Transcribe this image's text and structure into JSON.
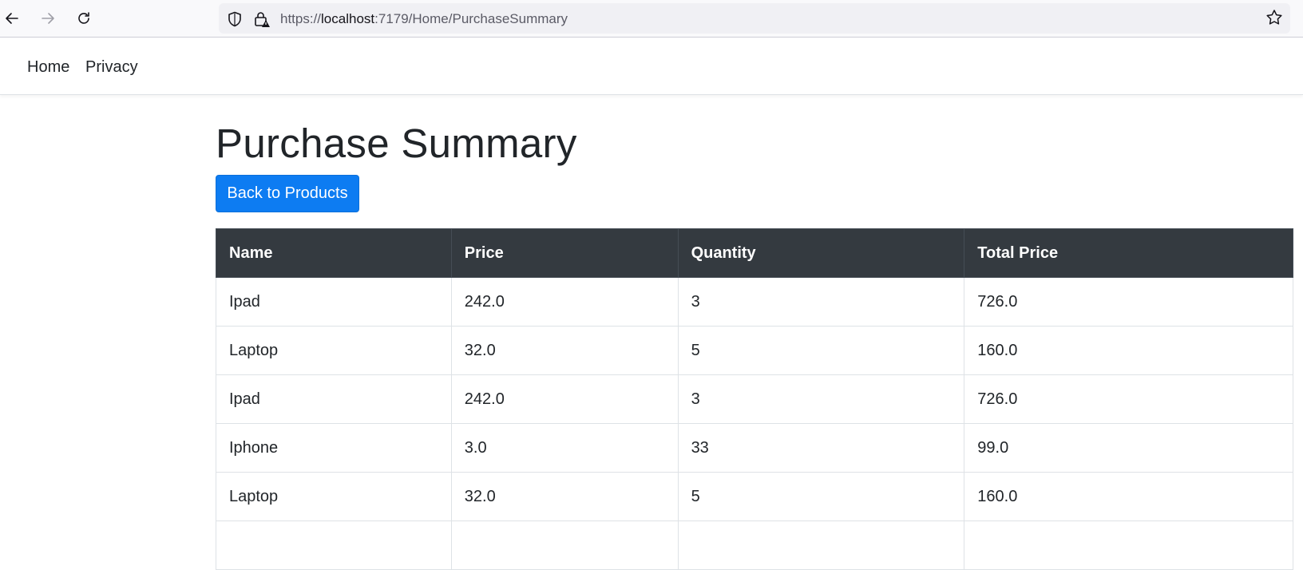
{
  "browser": {
    "url_prefix": "https://",
    "url_host": "localhost",
    "url_rest": ":7179/Home/PurchaseSummary"
  },
  "nav": {
    "home": "Home",
    "privacy": "Privacy"
  },
  "page": {
    "title": "Purchase Summary",
    "back_button": "Back to Products"
  },
  "table": {
    "headers": [
      "Name",
      "Price",
      "Quantity",
      "Total Price"
    ],
    "rows": [
      [
        "Ipad",
        "242.0",
        "3",
        "726.0"
      ],
      [
        "Laptop",
        "32.0",
        "5",
        "160.0"
      ],
      [
        "Ipad",
        "242.0",
        "3",
        "726.0"
      ],
      [
        "Iphone",
        "3.0",
        "33",
        "99.0"
      ],
      [
        "Laptop",
        "32.0",
        "5",
        "160.0"
      ],
      [
        "",
        "",
        "",
        ""
      ]
    ]
  }
}
